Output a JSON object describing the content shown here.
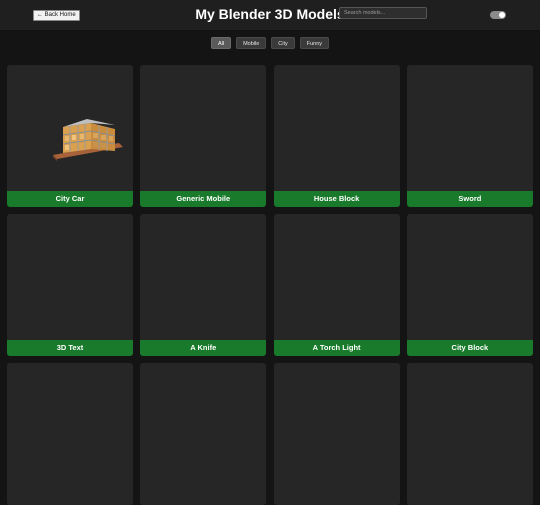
{
  "header": {
    "back_label": "← Back Home",
    "title": "My Blender 3D Models",
    "search_placeholder": "Search models..."
  },
  "filters": [
    "All",
    "Mobile",
    "City",
    "Funny"
  ],
  "active_filter": "All",
  "models": [
    {
      "label": "City Car",
      "has_preview": true
    },
    {
      "label": "Generic Mobile",
      "has_preview": false
    },
    {
      "label": "House Block",
      "has_preview": false
    },
    {
      "label": "Sword",
      "has_preview": false
    },
    {
      "label": "3D Text",
      "has_preview": false
    },
    {
      "label": "A Knife",
      "has_preview": false
    },
    {
      "label": "A Torch Light",
      "has_preview": false
    },
    {
      "label": "City Block",
      "has_preview": false
    },
    {
      "label": "",
      "has_preview": false
    },
    {
      "label": "",
      "has_preview": false
    },
    {
      "label": "",
      "has_preview": false
    },
    {
      "label": "",
      "has_preview": false
    }
  ],
  "colors": {
    "accent_green": "#187a2a",
    "background": "#141414",
    "card": "#262626"
  },
  "icons": {
    "theme_toggle": "toggle-switch-icon"
  }
}
